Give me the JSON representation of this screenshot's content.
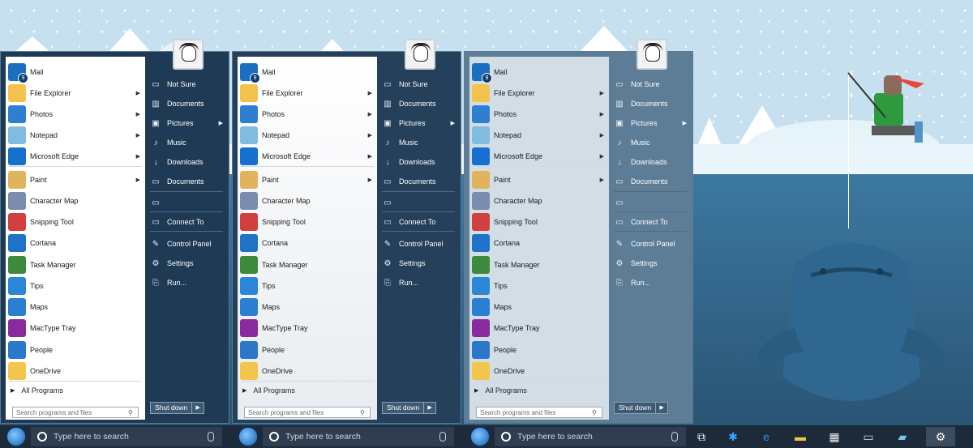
{
  "menus": [
    {
      "variant": "opaque"
    },
    {
      "variant": "gradient"
    },
    {
      "variant": "translucent"
    }
  ],
  "apps": [
    {
      "label": "Mail",
      "icon": "mail-icon",
      "color": "#1b6fc1",
      "arrow": false,
      "badge": "9"
    },
    {
      "label": "File Explorer",
      "icon": "folder-icon",
      "color": "#f3c24c",
      "arrow": true
    },
    {
      "label": "Photos",
      "icon": "photos-icon",
      "color": "#2f7fd1",
      "arrow": true
    },
    {
      "label": "Notepad",
      "icon": "notepad-icon",
      "color": "#7fbce0",
      "arrow": true
    },
    {
      "label": "Microsoft Edge",
      "icon": "edge-icon",
      "color": "#1570d0",
      "arrow": true
    },
    {
      "label": "Paint",
      "icon": "paint-icon",
      "color": "#e0b35c",
      "arrow": true
    },
    {
      "label": "Character Map",
      "icon": "charmap-icon",
      "color": "#7a8db0",
      "arrow": false
    },
    {
      "label": "Snipping Tool",
      "icon": "scissors-icon",
      "color": "#d04040",
      "arrow": false
    },
    {
      "label": "Cortana",
      "icon": "cortana-icon",
      "color": "#1e73c9",
      "arrow": false
    },
    {
      "label": "Task Manager",
      "icon": "task-manager-icon",
      "color": "#3d8a3d",
      "arrow": false
    },
    {
      "label": "Tips",
      "icon": "lightbulb-icon",
      "color": "#2a86d6",
      "arrow": false
    },
    {
      "label": "Maps",
      "icon": "maps-icon",
      "color": "#2a7fd0",
      "arrow": false
    },
    {
      "label": "MacType Tray",
      "icon": "mactype-icon",
      "color": "#8a2aa0",
      "arrow": false
    },
    {
      "label": "People",
      "icon": "people-icon",
      "color": "#2c78c8",
      "arrow": false
    },
    {
      "label": "OneDrive",
      "icon": "onedrive-icon",
      "color": "#f2c64c",
      "arrow": false
    }
  ],
  "all_programs": "All Programs",
  "search_placeholder": "Search programs and files",
  "right_items": [
    {
      "label": "Not Sure",
      "icon": "document-icon",
      "glyph": "▭",
      "arrow": false
    },
    {
      "label": "Documents",
      "icon": "library-icon",
      "glyph": "▥",
      "arrow": false
    },
    {
      "label": "Pictures",
      "icon": "picture-icon",
      "glyph": "▣",
      "arrow": true
    },
    {
      "label": "Music",
      "icon": "music-icon",
      "glyph": "♪",
      "arrow": false
    },
    {
      "label": "Downloads",
      "icon": "download-icon",
      "glyph": "↓",
      "arrow": false
    },
    {
      "label": "Documents",
      "icon": "document-icon",
      "glyph": "▭",
      "arrow": false
    },
    {
      "label": "",
      "icon": "computer-icon",
      "glyph": "▭",
      "arrow": false
    },
    {
      "label": "Connect To",
      "icon": "connect-icon",
      "glyph": "▭",
      "arrow": false
    },
    {
      "label": "Control Panel",
      "icon": "wrench-icon",
      "glyph": "✎",
      "arrow": false
    },
    {
      "label": "Settings",
      "icon": "gear-icon",
      "glyph": "⚙",
      "arrow": false
    },
    {
      "label": "Run...",
      "icon": "run-icon",
      "glyph": "⎘",
      "arrow": false
    }
  ],
  "shutdown_label": "Shut down",
  "taskbar": {
    "search_placeholder": "Type here to search",
    "pinned": [
      {
        "icon": "task-view-icon",
        "glyph": "⧉",
        "color": "#ffffff"
      },
      {
        "icon": "bug-icon",
        "glyph": "✱",
        "color": "#2fa8ff"
      },
      {
        "icon": "edge-icon",
        "glyph": "e",
        "color": "#2f8fe8"
      },
      {
        "icon": "folder-icon",
        "glyph": "▬",
        "color": "#f2c14a"
      },
      {
        "icon": "store-icon",
        "glyph": "▦",
        "color": "#f1f1f1"
      },
      {
        "icon": "terminal-icon",
        "glyph": "▭",
        "color": "#cccccc"
      },
      {
        "icon": "notepad-icon",
        "glyph": "▰",
        "color": "#7fc1e4"
      },
      {
        "icon": "gear-icon",
        "glyph": "⚙",
        "color": "#ffffff"
      }
    ]
  },
  "colors": {
    "menu_dark": "#1f3a55",
    "taskbar": "#1c2a3a",
    "sky": "#c7e0f0",
    "water": "#2b5573"
  }
}
